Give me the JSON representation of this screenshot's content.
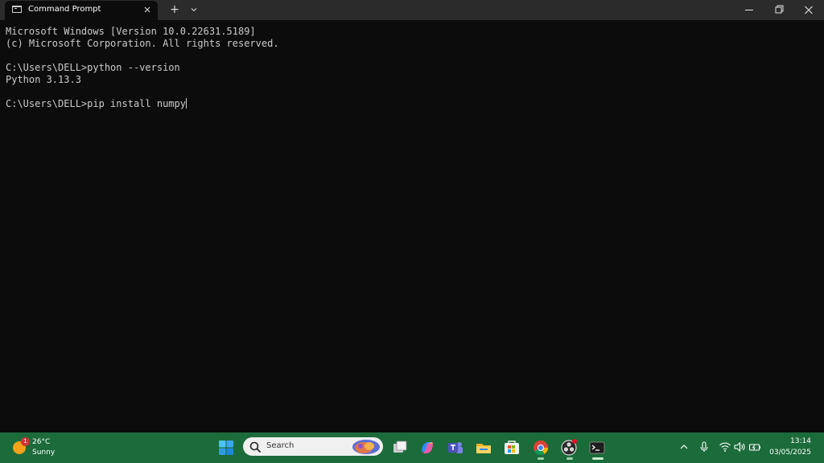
{
  "window": {
    "tab_title": "Command Prompt",
    "new_tab_label": "+"
  },
  "terminal": {
    "lines": [
      "Microsoft Windows [Version 10.0.22631.5189]",
      "(c) Microsoft Corporation. All rights reserved.",
      "",
      "C:\\Users\\DELL>python --version",
      "Python 3.13.3",
      "",
      "C:\\Users\\DELL>pip install numpy"
    ]
  },
  "taskbar": {
    "weather": {
      "temperature": "26°C",
      "condition": "Sunny",
      "badge": "1"
    },
    "search": {
      "placeholder": "Search"
    },
    "pinned_apps": [
      "start-icon",
      "task-view-icon",
      "copilot-icon",
      "teams-icon",
      "file-explorer-icon",
      "microsoft-store-icon",
      "chrome-icon",
      "obs-icon",
      "terminal-icon"
    ],
    "clock": {
      "time": "13:14",
      "date": "03/05/2025"
    }
  },
  "colors": {
    "terminal_bg": "#0c0c0c",
    "terminal_text": "#cccccc",
    "titlebar_bg": "#2b2b2b",
    "taskbar_bg": "#1c6b3a"
  }
}
